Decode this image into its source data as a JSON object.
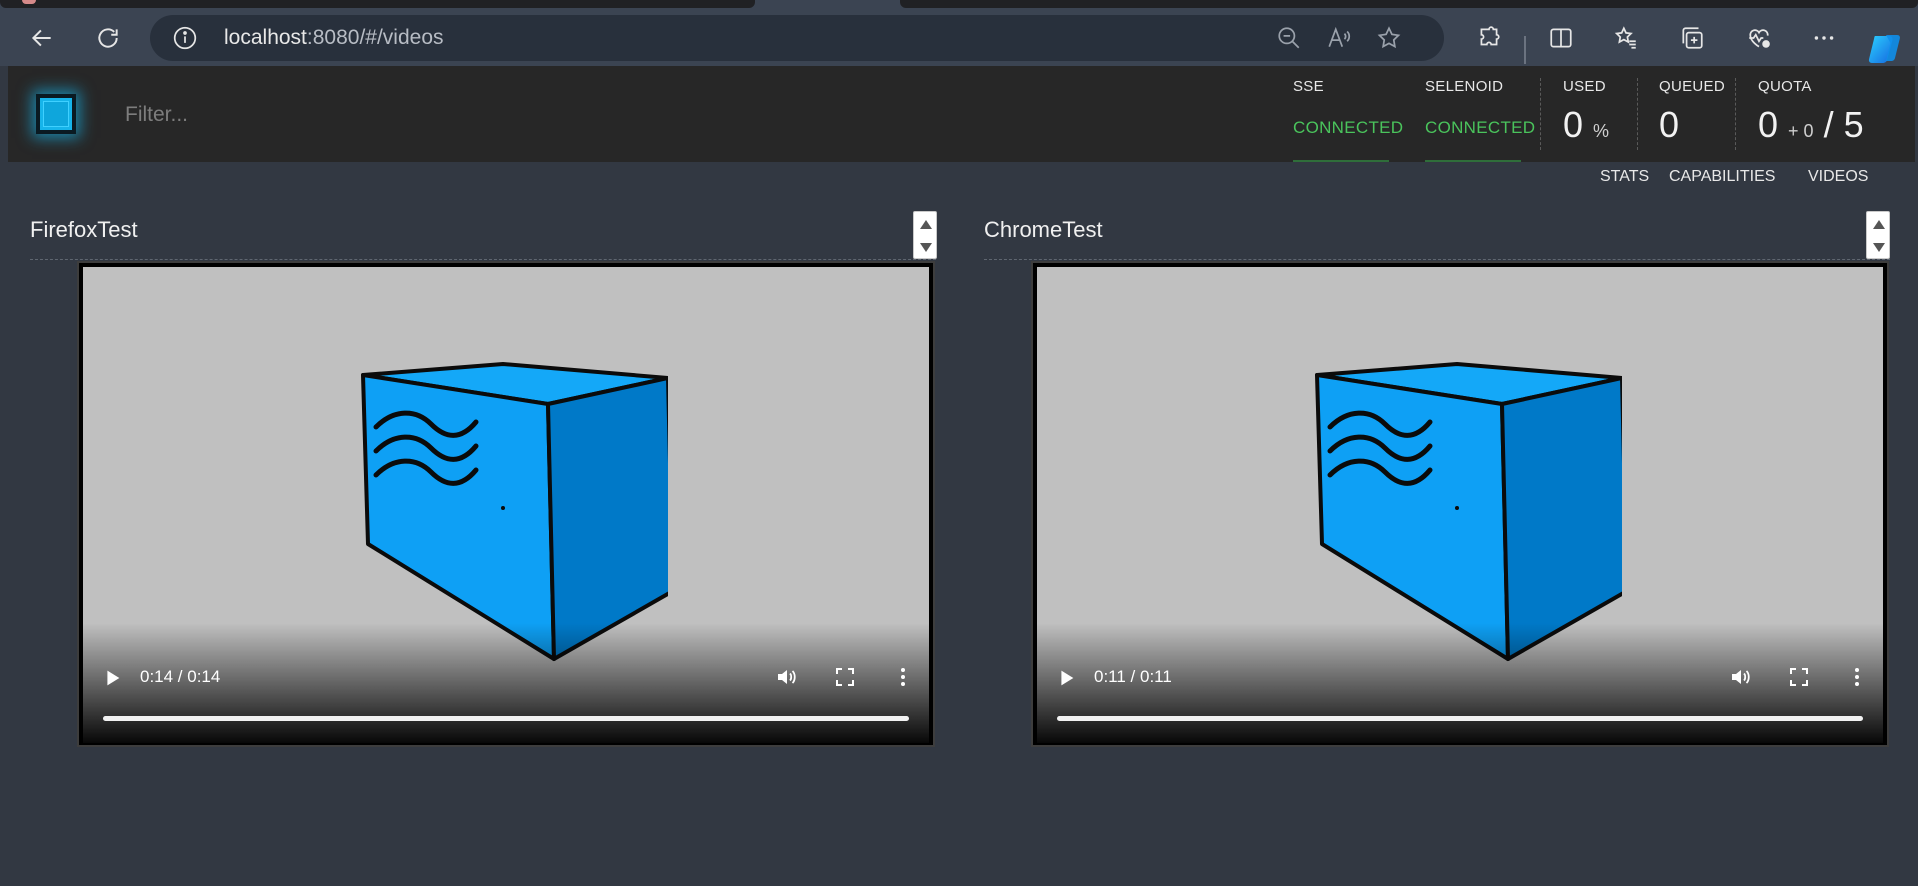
{
  "browser": {
    "url_host": "localhost",
    "url_rest": ":8080/#/videos"
  },
  "header": {
    "filter_placeholder": "Filter...",
    "sse": {
      "label": "SSE",
      "status": "CONNECTED"
    },
    "selenoid": {
      "label": "SELENOID",
      "status": "CONNECTED"
    },
    "used": {
      "label": "USED",
      "value": "0",
      "unit": "%"
    },
    "queued": {
      "label": "QUEUED",
      "value": "0"
    },
    "quota": {
      "label": "QUOTA",
      "value": "0",
      "plus": "+ 0",
      "total": "/ 5"
    }
  },
  "nav": {
    "stats": "STATS",
    "capabilities": "CAPABILITIES",
    "videos": "VIDEOS"
  },
  "videos": [
    {
      "title": "FirefoxTest",
      "time": "0:14 / 0:14",
      "played_fraction": 1.0
    },
    {
      "title": "ChromeTest",
      "time": "0:11 / 0:11",
      "played_fraction": 1.0
    }
  ],
  "colors": {
    "accent_green": "#4ac45c",
    "cube_light": "#0ea0f5",
    "cube_dark": "#0079c8",
    "logo": "#16b4ea"
  }
}
